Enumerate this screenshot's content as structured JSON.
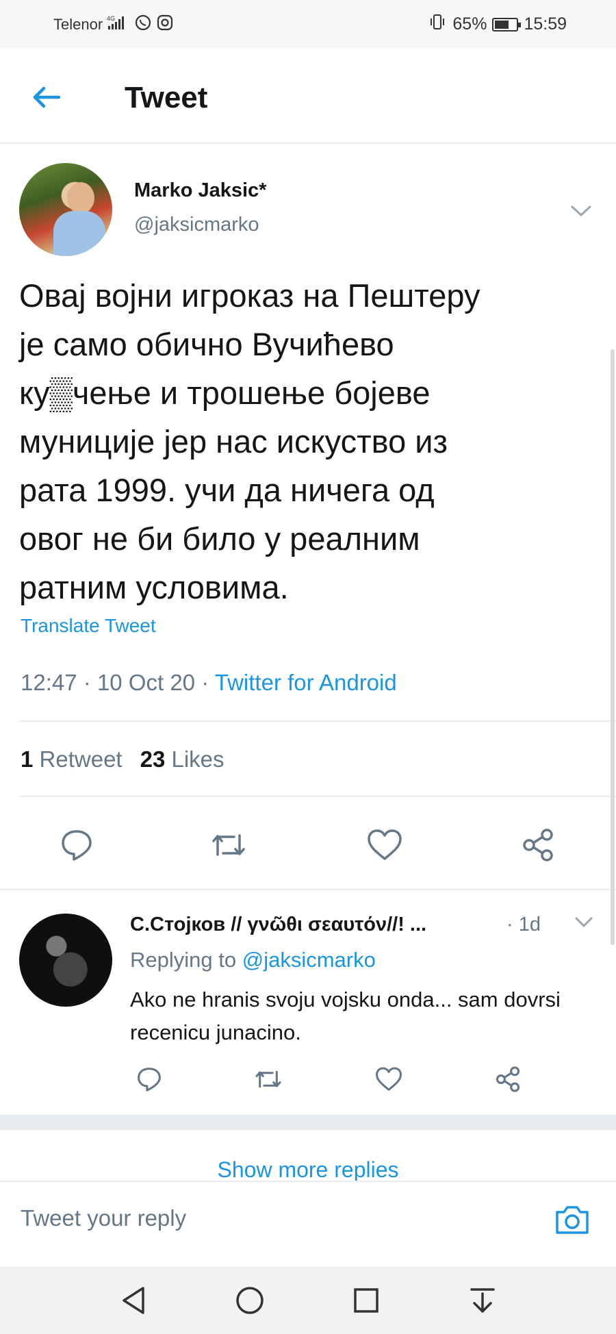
{
  "status_bar": {
    "carrier": "Telenor",
    "network": "4G",
    "battery_percent": "65%",
    "battery_level": 0.65,
    "time": "15:59"
  },
  "header": {
    "title": "Tweet"
  },
  "tweet": {
    "author_name": "Marko Jaksic*",
    "author_handle": "@jaksicmarko",
    "lines": [
      "Овај војни игроказ на Пештеру",
      "је само обично Вучићево",
      "ку▒чење и трошење бојеве",
      "муниције јер нас искуство из",
      "рата 1999. учи да ничега од",
      "овог не би било у реалним",
      "ратним условима."
    ],
    "translate_label": "Translate Tweet",
    "time": "12:47",
    "date": "10 Oct 20",
    "source": "Twitter for Android",
    "retweet_count": "1",
    "retweet_label": "Retweet",
    "like_count": "23",
    "like_label": "Likes"
  },
  "reply": {
    "author_name": "С.Стојков // γνῶθι σεαυτόν//! ...",
    "time": "· 1d",
    "replying_prefix": "Replying to",
    "replying_handle": "@jaksicmarko",
    "text": "Ako ne hranis svoju vojsku onda... sam dovrsi recenicu junacino."
  },
  "show_more_label": "Show more replies",
  "compose": {
    "placeholder": "Tweet your reply"
  },
  "colors": {
    "accent": "#1b95e0",
    "secondary_text": "#657786",
    "divider": "#e6ecf0"
  }
}
